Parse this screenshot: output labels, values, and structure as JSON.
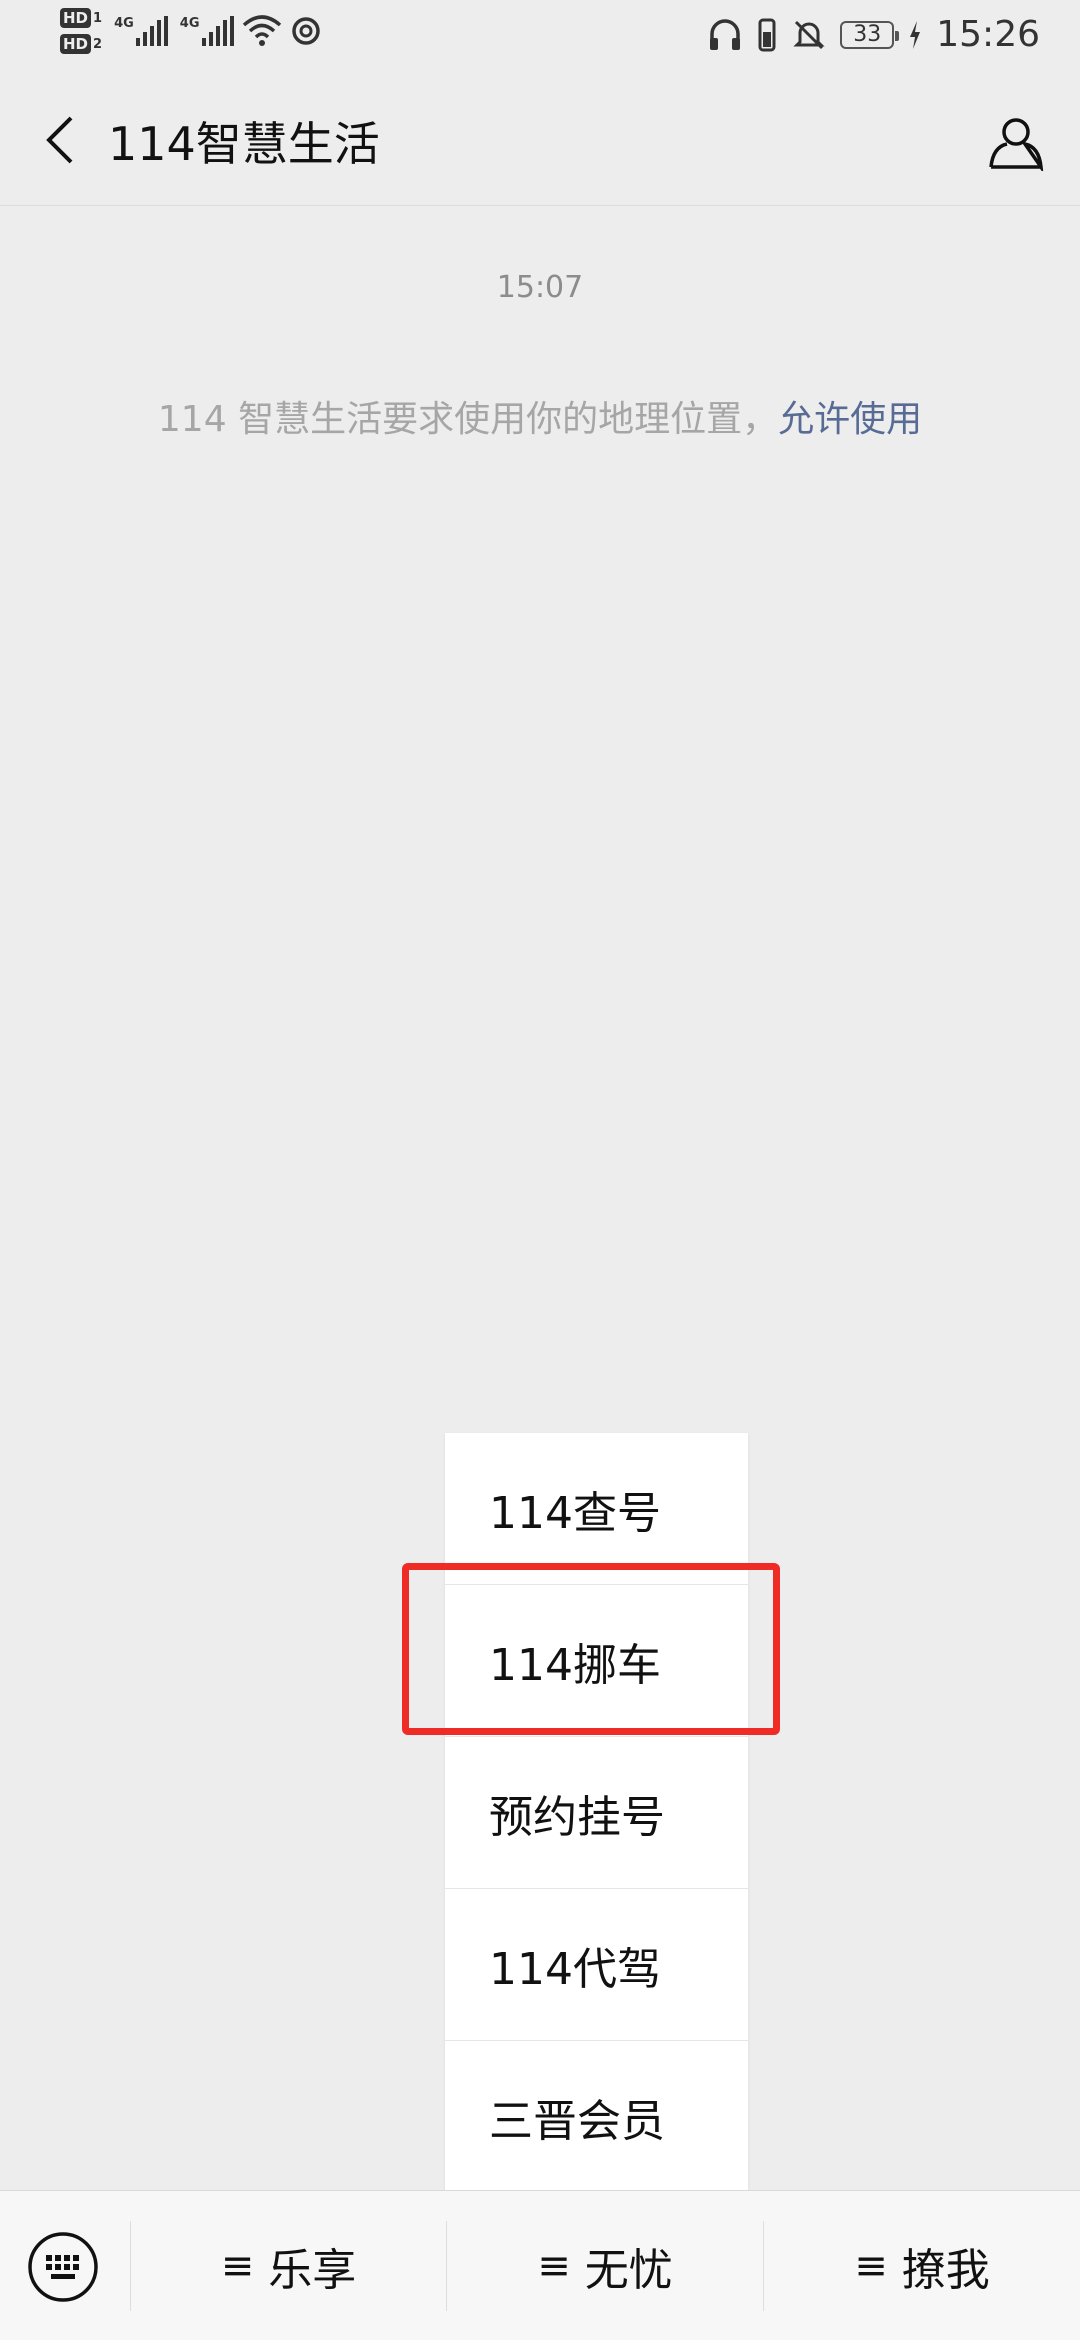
{
  "status_bar": {
    "sim1_badge": "HD",
    "sim1_index": "1",
    "sim2_badge": "HD",
    "sim2_index": "2",
    "net1": "4G",
    "net2": "4G",
    "battery_level": "33",
    "time": "15:26"
  },
  "header": {
    "title": "114智慧生活"
  },
  "chat": {
    "timestamp": "15:07",
    "system_message": "114 智慧生活要求使用你的地理位置，",
    "system_link": "允许使用"
  },
  "popup_menu": {
    "items": [
      "114查号",
      "114挪车",
      "预约挂号",
      "114代驾",
      "三晋会员"
    ],
    "highlighted_index": 1,
    "highlight_color": "#ee2b24"
  },
  "bottom_menu": {
    "items": [
      "乐享",
      "无忧",
      "撩我"
    ],
    "hamburger_glyph": "≡"
  },
  "colors": {
    "background": "#ededed",
    "link": "#576b95"
  }
}
